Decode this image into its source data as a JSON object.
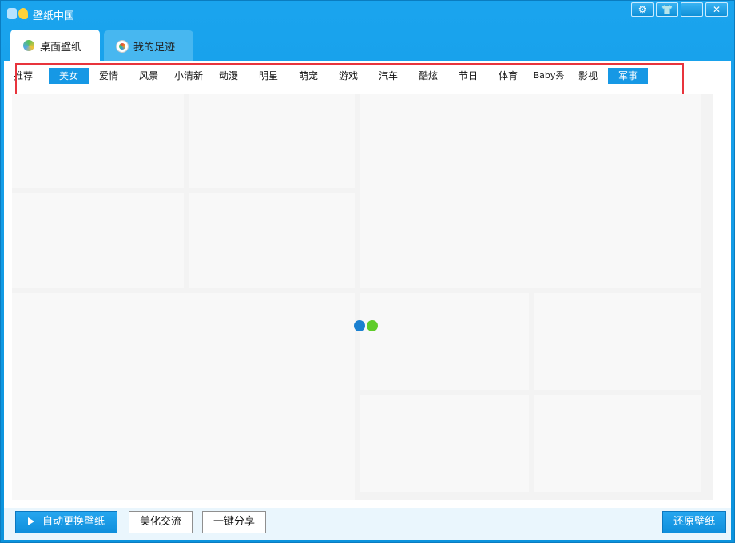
{
  "window": {
    "title": "壁纸中国"
  },
  "window_controls": [
    {
      "name": "settings-icon",
      "glyph": "⚙"
    },
    {
      "name": "skin-icon",
      "glyph": "👕"
    },
    {
      "name": "minimize-icon",
      "glyph": "—"
    },
    {
      "name": "close-icon",
      "glyph": "✕"
    }
  ],
  "tabs": [
    {
      "label": "桌面壁纸",
      "active": true
    },
    {
      "label": "我的足迹",
      "active": false
    }
  ],
  "categories": [
    {
      "label": "推荐",
      "selected": false
    },
    {
      "label": "美女",
      "selected": true
    },
    {
      "label": "爱情",
      "selected": false
    },
    {
      "label": "风景",
      "selected": false
    },
    {
      "label": "小清新",
      "selected": false
    },
    {
      "label": "动漫",
      "selected": false
    },
    {
      "label": "明星",
      "selected": false
    },
    {
      "label": "萌宠",
      "selected": false
    },
    {
      "label": "游戏",
      "selected": false
    },
    {
      "label": "汽车",
      "selected": false
    },
    {
      "label": "酷炫",
      "selected": false
    },
    {
      "label": "节日",
      "selected": false
    },
    {
      "label": "体育",
      "selected": false
    },
    {
      "label": "Baby秀",
      "selected": false
    },
    {
      "label": "影视",
      "selected": false
    },
    {
      "label": "军事",
      "selected": true
    }
  ],
  "footer": {
    "auto_change": "自动更换壁纸",
    "beautify": "美化交流",
    "share": "一键分享",
    "restore": "还原壁纸"
  },
  "colors": {
    "accent": "#1698e5",
    "highlight_border": "#e8343c",
    "loader_blue": "#1b80d0",
    "loader_green": "#5fcc2a"
  }
}
